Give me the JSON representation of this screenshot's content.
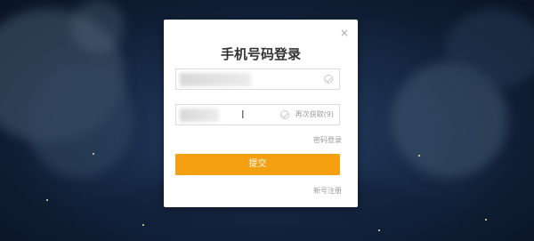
{
  "dialog": {
    "title": "手机号码登录",
    "close_label": "×",
    "phone_field": {
      "value": "",
      "placeholder": ""
    },
    "code_field": {
      "value": "",
      "placeholder": "",
      "resend_label": "再次获取(9)"
    },
    "password_login_link": "密码登录",
    "submit_label": "提交",
    "register_link": "新号注册",
    "accent_color": "#f5a010"
  },
  "icons": {
    "close": "close-icon",
    "phone_clear": "check-circle-icon",
    "code_clear": "check-circle-icon",
    "cursor": "text-cursor-icon"
  }
}
